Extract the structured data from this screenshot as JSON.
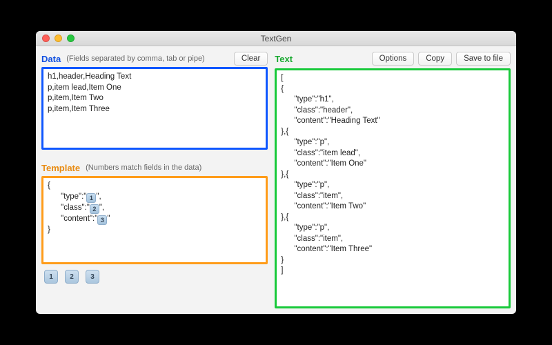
{
  "window": {
    "title": "TextGen"
  },
  "data_panel": {
    "label": "Data",
    "hint": "(Fields separated by comma, tab or pipe)",
    "clear_label": "Clear",
    "content": "h1,header,Heading Text\np,item lead,Item One\np,item,Item Two\np,item,Item Three"
  },
  "template_panel": {
    "label": "Template",
    "hint": "(Numbers match fields in the data)",
    "line1": "{",
    "kv_type": "      \"type\":\"",
    "kv_class": "      \"class\":\"",
    "kv_content": "      \"content\":\"",
    "chip1": "1",
    "chip2": "2",
    "chip3": "3",
    "tail1": "\",",
    "tail2": "\",",
    "tail3": "\"",
    "line5": "}"
  },
  "numberbar": {
    "n1": "1",
    "n2": "2",
    "n3": "3"
  },
  "text_panel": {
    "label": "Text",
    "options_label": "Options",
    "copy_label": "Copy",
    "save_label": "Save to file",
    "content": "[\n{\n      \"type\":\"h1\",\n      \"class\":\"header\",\n      \"content\":\"Heading Text\"\n},{\n      \"type\":\"p\",\n      \"class\":\"item lead\",\n      \"content\":\"Item One\"\n},{\n      \"type\":\"p\",\n      \"class\":\"item\",\n      \"content\":\"Item Two\"\n},{\n      \"type\":\"p\",\n      \"class\":\"item\",\n      \"content\":\"Item Three\"\n}\n]"
  }
}
